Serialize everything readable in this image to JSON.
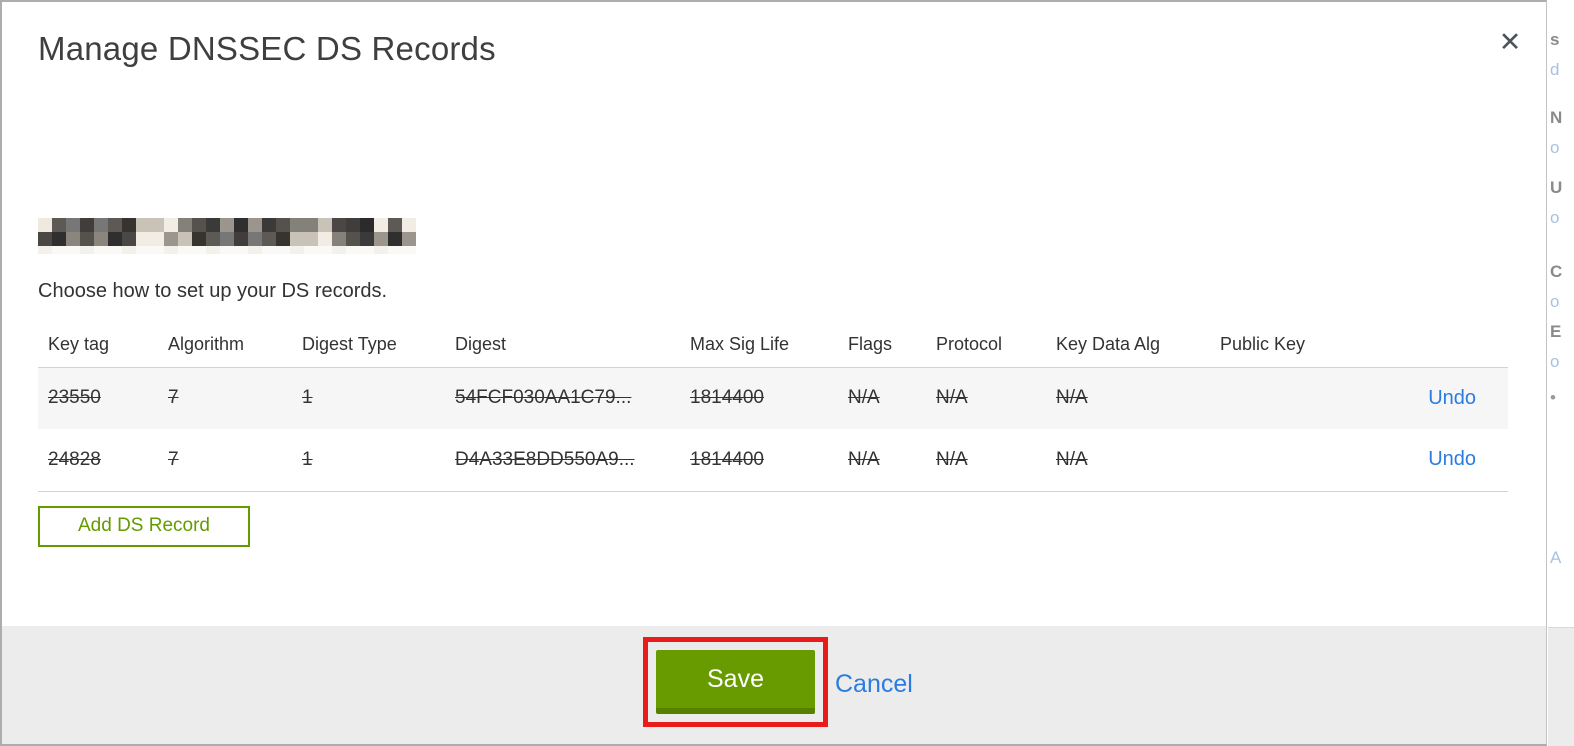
{
  "modal": {
    "title": "Manage DNSSEC DS Records",
    "close_icon": "close-x",
    "instruction": "Choose how to set up your DS records.",
    "table": {
      "headers": [
        "Key tag",
        "Algorithm",
        "Digest Type",
        "Digest",
        "Max Sig Life",
        "Flags",
        "Protocol",
        "Key Data Alg",
        "Public Key"
      ],
      "rows": [
        {
          "cells": [
            "23550",
            "7",
            "1",
            "54FCF030AA1C79...",
            "1814400",
            "N/A",
            "N/A",
            "N/A",
            ""
          ],
          "action": "Undo",
          "deleted": true
        },
        {
          "cells": [
            "24828",
            "7",
            "1",
            "D4A33E8DD550A9...",
            "1814400",
            "N/A",
            "N/A",
            "N/A",
            ""
          ],
          "action": "Undo",
          "deleted": true
        }
      ]
    },
    "add_button_label": "Add DS Record",
    "footer": {
      "save_label": "Save",
      "cancel_label": "Cancel"
    }
  },
  "background_strip": {
    "fragments": [
      "s",
      "d",
      "N",
      "o",
      "U",
      "o",
      "C",
      "o",
      "E",
      "o",
      "•",
      "A"
    ]
  },
  "colors": {
    "accent_green": "#679b00",
    "green_border": "#649b00",
    "annotation_red": "#ea1b1b",
    "link_blue": "#2b7ce0",
    "footer_gray": "#ececec",
    "row_stripe": "#f6f6f6"
  }
}
